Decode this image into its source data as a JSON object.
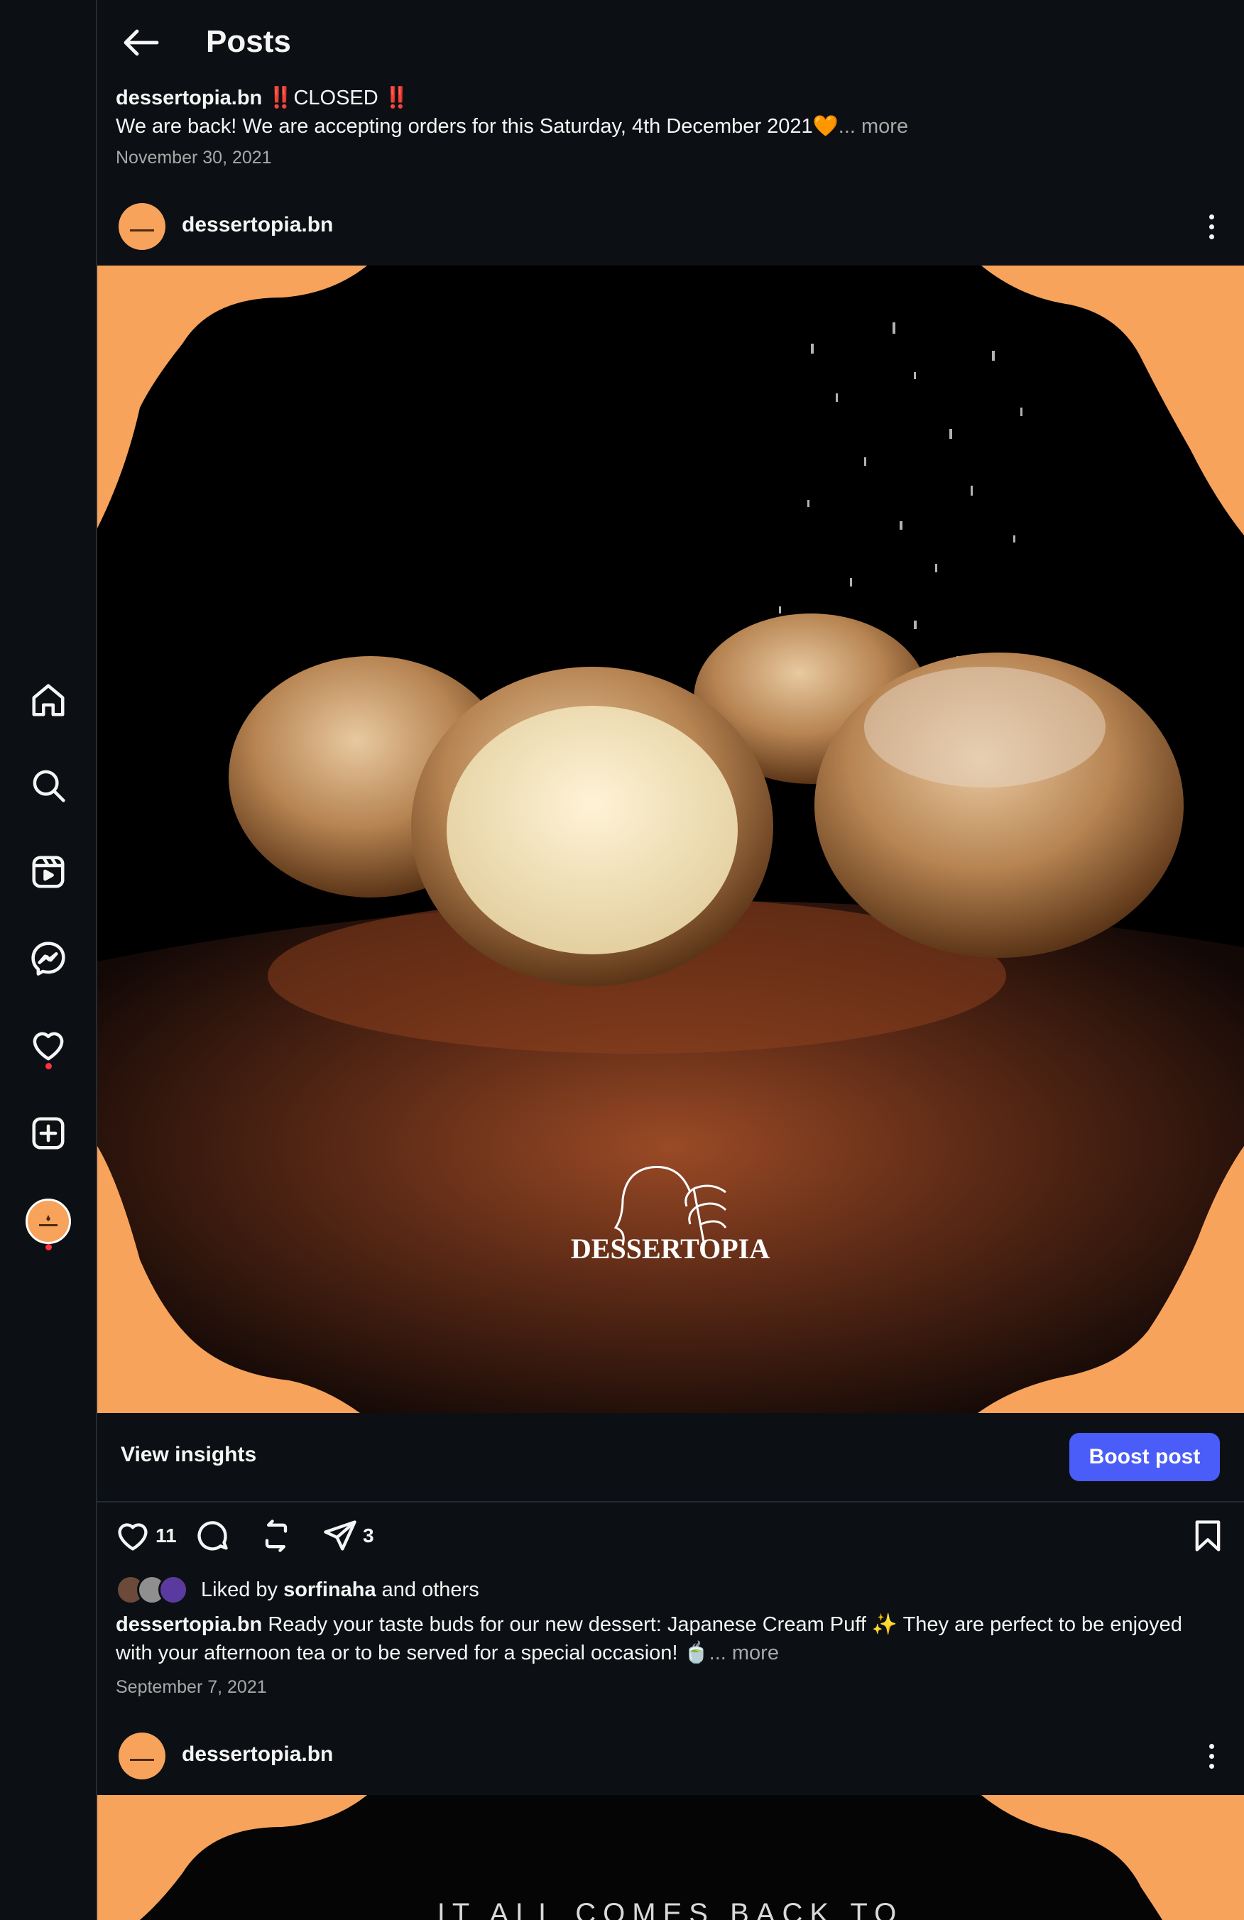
{
  "header": {
    "title": "Posts"
  },
  "previous_post": {
    "username": "dessertopia.bn",
    "caption_title": "‼️CLOSED ‼️",
    "caption_text": "We are back! We are accepting orders for this Saturday, 4th December 2021🧡",
    "more_label": "... more",
    "date": "November 30, 2021"
  },
  "post": {
    "username": "dessertopia.bn",
    "image_logo_text": "DESSERTOPIA",
    "view_insights_label": "View insights",
    "boost_label": "Boost post",
    "like_count": "11",
    "share_count": "3",
    "liked_by_prefix": "Liked by",
    "liked_by_user": "sorfinaha",
    "liked_by_suffix": "and others",
    "caption_user": "dessertopia.bn",
    "caption_text": "Ready your taste buds for our new dessert: Japanese Cream Puff ✨ They are perfect to be enjoyed with your afternoon tea or to be served for a special occasion! 🍵",
    "more_label": "... more",
    "date": "September 7, 2021"
  },
  "next_post": {
    "username": "dessertopia.bn",
    "image_text": "IT ALL COMES BACK TO"
  },
  "sidebar": {
    "items": [
      "home-icon",
      "search-icon",
      "reels-icon",
      "messenger-icon",
      "heart-icon",
      "create-icon",
      "profile-avatar"
    ]
  },
  "colors": {
    "accent": "#4a5df9",
    "brand_orange": "#f7a35c",
    "notification": "#ff3040",
    "background": "#0c1014"
  }
}
